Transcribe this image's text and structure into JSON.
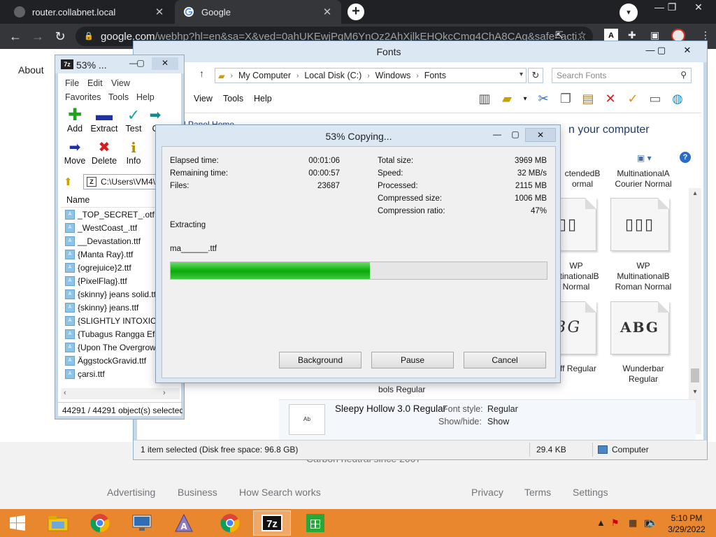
{
  "browser": {
    "tabs": [
      {
        "title": "router.collabnet.local",
        "close": "✕"
      },
      {
        "title": "Google",
        "close": "✕"
      }
    ],
    "new_tab": "+",
    "url_host": "google.com",
    "url_path": "/webhp?hl=en&sa=X&ved=0ahUKEwjPqM6YnOz2AhXjlkEHQkcCmg4ChA8CAg&safe=acti..."
  },
  "google_page": {
    "about": "About",
    "carbon": "Carbon neutral since 2007",
    "footer": [
      "Advertising",
      "Business",
      "How Search works",
      "Privacy",
      "Terms",
      "Settings"
    ]
  },
  "explorer": {
    "title": "Fonts",
    "breadcrumb": [
      "My Computer",
      "Local Disk (C:)",
      "Windows",
      "Fonts"
    ],
    "search_placeholder": "Search Fonts",
    "menu": [
      "View",
      "Tools",
      "Help"
    ],
    "panel_home": "l Panel Home",
    "heading": "n your computer",
    "fonts": [
      {
        "line1": "ctendedB",
        "line2": "ormal"
      },
      {
        "line1": "MultinationalA",
        "line2": "Courier Normal"
      },
      {
        "line1": "WP",
        "line2": "ultinationalB",
        "line3": "Normal"
      },
      {
        "line1": "WP",
        "line2": "MultinationalB",
        "line3": "Roman Normal"
      },
      {
        "line1": "ff Regular"
      },
      {
        "line1": "Wunderbar",
        "line2": "Regular"
      }
    ],
    "glyphs": [
      "▯▯",
      "▯▯▯",
      "BG",
      "ABG"
    ],
    "partial_label": "bols Regular",
    "details": {
      "name": "Sleepy Hollow 3.0 Regular",
      "font_style_label": "Font style:",
      "font_style_value": "Regular",
      "show_hide_label": "Show/hide:",
      "show_hide_value": "Show"
    },
    "status": {
      "selection": "1 item selected (Disk free space: 96.8 GB)",
      "size": "29.4 KB",
      "location": "Computer"
    }
  },
  "sevenzip": {
    "title": "53% ...",
    "menu": [
      "File",
      "Edit",
      "View",
      "Favorites",
      "Tools",
      "Help"
    ],
    "tools": [
      {
        "label": "Add"
      },
      {
        "label": "Extract"
      },
      {
        "label": "Test"
      },
      {
        "label": "C"
      },
      {
        "label": "Move"
      },
      {
        "label": "Delete"
      },
      {
        "label": "Info"
      }
    ],
    "path": "C:\\Users\\VM4\\",
    "column_name": "Name",
    "files": [
      "_TOP_SECRET_.otf",
      "_WestCoast_.ttf",
      "__Devastation.ttf",
      "{Manta Ray}.ttf",
      "{ogrejuice}2.ttf",
      "{PixelFlag}.ttf",
      "{skinny} jeans solid.ttf",
      "{skinny} jeans.ttf",
      "{SLIGHTLY INTOXICAT",
      "{Tubagus Rangga Efa",
      "{Upon The Overgrow",
      "ÄggstockGravid.ttf",
      "çarsi.ttf"
    ],
    "status": "44291 / 44291 object(s) selected"
  },
  "copy_dialog": {
    "title": "53% Copying...",
    "left_stats": [
      {
        "label": "Elapsed time:",
        "value": "00:01:06"
      },
      {
        "label": "Remaining time:",
        "value": "00:00:57"
      },
      {
        "label": "Files:",
        "value": "23687"
      }
    ],
    "right_stats": [
      {
        "label": "Total size:",
        "value": "3969 MB"
      },
      {
        "label": "Speed:",
        "value": "32 MB/s"
      },
      {
        "label": "Processed:",
        "value": "2115 MB"
      },
      {
        "label": "Compressed size:",
        "value": "1006 MB"
      },
      {
        "label": "Compression ratio:",
        "value": "47%"
      }
    ],
    "operation": "Extracting",
    "current_file": "ma______.ttf",
    "progress": 0.53,
    "buttons": [
      "Background",
      "Pause",
      "Cancel"
    ]
  },
  "taskbar": {
    "time": "5:10 PM",
    "date": "3/29/2022"
  }
}
